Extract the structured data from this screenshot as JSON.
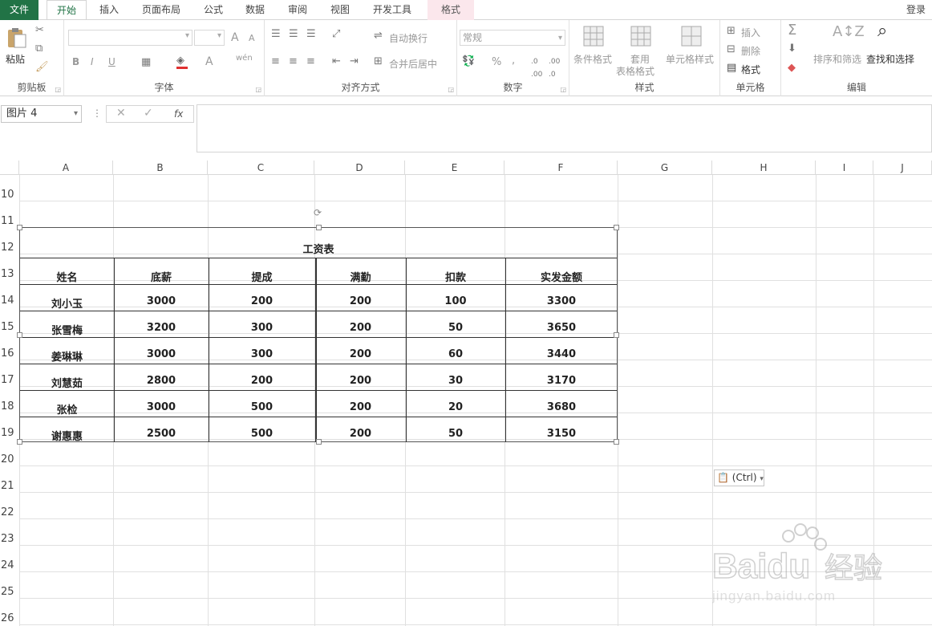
{
  "tabs": [
    "文件",
    "开始",
    "插入",
    "页面布局",
    "公式",
    "数据",
    "审阅",
    "视图",
    "开发工具",
    "格式"
  ],
  "login": "登录",
  "ribbon": {
    "clipboard": {
      "label": "剪贴板",
      "paste": "粘贴"
    },
    "font": {
      "label": "字体",
      "bold": "B",
      "italic": "I",
      "underline": "U",
      "grow": "A",
      "shrink": "A",
      "color_a": "A",
      "wen": "wén"
    },
    "align": {
      "label": "对齐方式",
      "wrap": "自动换行",
      "merge": "合并后居中"
    },
    "number": {
      "label": "数字",
      "format": "常规",
      "percent": "%",
      "comma": ","
    },
    "styles": {
      "label": "样式",
      "cond": "条件格式",
      "table1": "套用",
      "table2": "表格格式",
      "cell": "单元格样式"
    },
    "cells": {
      "label": "单元格",
      "insert": "插入",
      "delete": "删除",
      "format": "格式"
    },
    "edit": {
      "label": "编辑",
      "sigma": "Σ",
      "sort": "排序和筛选",
      "find": "查找和选择"
    }
  },
  "formula_bar": {
    "name_box": "图片 4",
    "fx": "fx"
  },
  "columns": [
    "A",
    "B",
    "C",
    "D",
    "E",
    "F",
    "G",
    "H",
    "I",
    "J"
  ],
  "rows": [
    "10",
    "11",
    "12",
    "13",
    "14",
    "15",
    "16",
    "17",
    "18",
    "19",
    "20",
    "21",
    "22",
    "23",
    "24",
    "25",
    "26"
  ],
  "table": {
    "title": "工资表",
    "headers": [
      "姓名",
      "底薪",
      "提成",
      "满勤",
      "扣款",
      "实发金额"
    ],
    "rows": [
      [
        "刘小玉",
        "3000",
        "200",
        "200",
        "100",
        "3300"
      ],
      [
        "张雪梅",
        "3200",
        "300",
        "200",
        "50",
        "3650"
      ],
      [
        "姜琳琳",
        "3000",
        "300",
        "200",
        "60",
        "3440"
      ],
      [
        "刘慧茹",
        "2800",
        "200",
        "200",
        "30",
        "3170"
      ],
      [
        "张检",
        "3000",
        "500",
        "200",
        "20",
        "3680"
      ],
      [
        "谢惠惠",
        "2500",
        "500",
        "200",
        "50",
        "3150"
      ]
    ]
  },
  "paste_options": "(Ctrl)",
  "watermark": {
    "brand": "Baidu",
    "cn": "经验",
    "url": "jingyan.baidu.com"
  },
  "colors": {
    "file_tab": "#217346",
    "format_tab": "#fbe7ec"
  }
}
